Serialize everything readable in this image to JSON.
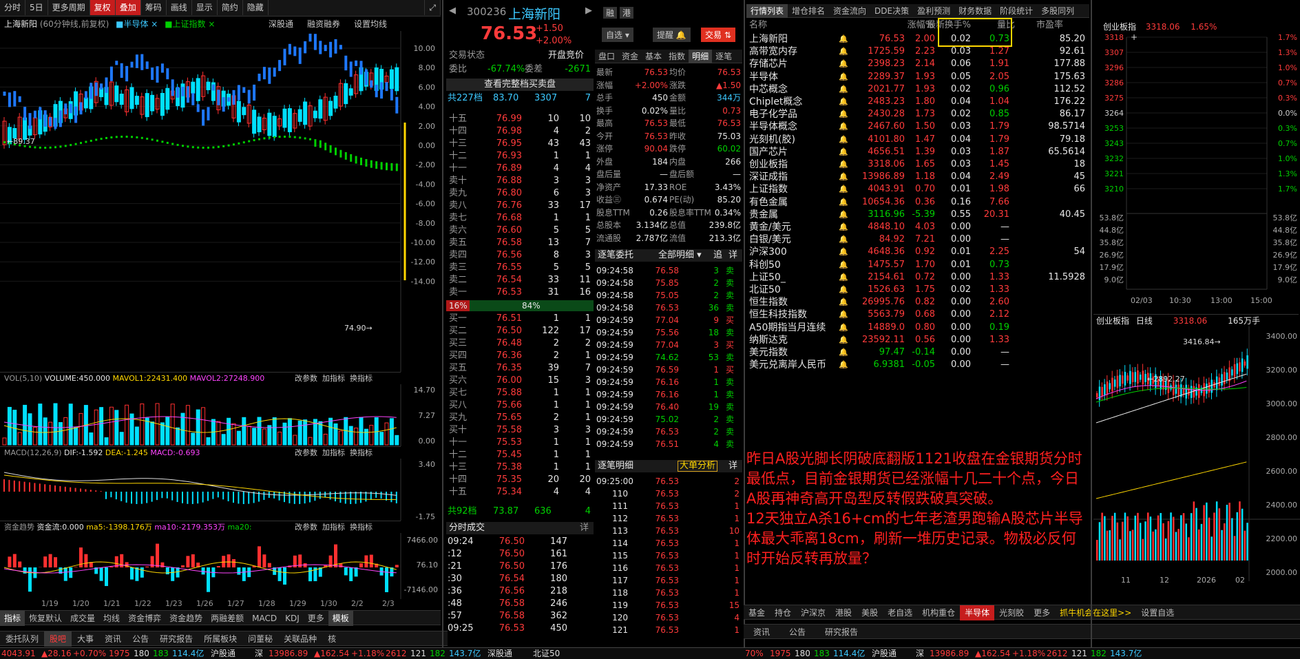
{
  "toolbar": {
    "items": [
      "分时",
      "5日",
      "更多周期",
      "复权",
      "叠加",
      "筹码",
      "画线",
      "显示",
      "简约",
      "隐藏"
    ]
  },
  "chart_header": {
    "name": "上海新阳",
    "desc": "(60分钟线,前复权)",
    "overlays": [
      "半导体",
      "上证指数"
    ],
    "links": [
      "深股通",
      "融资融券",
      "设置均线"
    ]
  },
  "kline": {
    "y_labels": [
      "10.00",
      "8.00",
      "6.00",
      "4.00",
      "2.00",
      "0.00",
      "-2.00",
      "-4.00",
      "-6.00",
      "-8.00",
      "-10.00",
      "-12.00",
      "-14.00"
    ],
    "high_label": "89.37",
    "low_label": "74.90",
    "colors": {
      "up": "#ff3030",
      "down": "#00e0ff",
      "semi": "#1e78ff",
      "index": "#00d000"
    }
  },
  "vol_header": {
    "name": "VOL(5,10)",
    "vol": "VOLUME:450.000",
    "mavol1": "MAVOL1:22431.400",
    "mavol2": "MAVOL2:27248.900",
    "links": [
      "改参数",
      "加指标",
      "换指标"
    ],
    "y": [
      "14.70",
      "7.27",
      "0.00"
    ]
  },
  "macd_header": {
    "name": "MACD(12,26,9)",
    "dif": "DIF:-1.592",
    "dea": "DEA:-1.245",
    "macd": "MACD:-0.693",
    "links": [
      "改参数",
      "加指标",
      "换指标"
    ],
    "y": [
      "3.40",
      "-1.75"
    ]
  },
  "fund_header": {
    "name": "资金趋势",
    "flow": "资金流:0.000",
    "ma5": "ma5:-1398.176万",
    "ma10": "ma10:-2179.353万",
    "ma20": "ma20:",
    "links": [
      "改参数",
      "加指标",
      "换指标"
    ],
    "y": [
      "7466.00",
      "76.10",
      "-7146.00"
    ]
  },
  "x_dates": [
    "1/19",
    "1/20",
    "1/21",
    "1/22",
    "1/23",
    "1/26",
    "1/27",
    "1/28",
    "1/29",
    "1/30",
    "2/2",
    "2/3"
  ],
  "indicator_tabs": [
    "指标",
    "恢复默认",
    "成交量",
    "均线",
    "资金博弈",
    "资金趋势",
    "两融差额",
    "MACD",
    "KDJ",
    "更多",
    "模板"
  ],
  "stock": {
    "code": "300236",
    "name": "上海新阳",
    "price": "76.53",
    "chg": "+1.50",
    "pct": "+2.00%",
    "tags": [
      "融",
      "港"
    ],
    "buttons": [
      "自选",
      "提醒",
      "交易"
    ]
  },
  "quote_state": {
    "title": "交易状态",
    "right": "开盘竞价",
    "wb_label": "委比",
    "wb": "-67.74%",
    "wc_label": "委差",
    "wc": "-2671",
    "full": "查看完整档买卖盘",
    "sell_sum": [
      "共227档",
      "83.70",
      "3307",
      "7"
    ],
    "buy_sum": [
      "共92档",
      "73.87",
      "636",
      "4"
    ],
    "ratio": [
      "16%",
      "84%"
    ]
  },
  "asks": [
    [
      "十五",
      "76.99",
      "10",
      "10"
    ],
    [
      "十四",
      "76.98",
      "4",
      "2"
    ],
    [
      "十三",
      "76.95",
      "43",
      "43"
    ],
    [
      "十二",
      "76.93",
      "1",
      "1"
    ],
    [
      "十一",
      "76.89",
      "4",
      "4"
    ],
    [
      "卖十",
      "76.88",
      "3",
      "3"
    ],
    [
      "卖九",
      "76.80",
      "6",
      "3"
    ],
    [
      "卖八",
      "76.76",
      "33",
      "17"
    ],
    [
      "卖七",
      "76.68",
      "1",
      "1"
    ],
    [
      "卖六",
      "76.60",
      "5",
      "5"
    ],
    [
      "卖五",
      "76.58",
      "13",
      "7"
    ],
    [
      "卖四",
      "76.56",
      "8",
      "3"
    ],
    [
      "卖三",
      "76.55",
      "5",
      "5"
    ],
    [
      "卖二",
      "76.54",
      "33",
      "11"
    ],
    [
      "卖一",
      "76.53",
      "31",
      "16"
    ]
  ],
  "bids": [
    [
      "买一",
      "76.51",
      "1",
      "1"
    ],
    [
      "买二",
      "76.50",
      "122",
      "17"
    ],
    [
      "买三",
      "76.48",
      "2",
      "2"
    ],
    [
      "买四",
      "76.36",
      "2",
      "1"
    ],
    [
      "买五",
      "76.35",
      "39",
      "7"
    ],
    [
      "买六",
      "76.00",
      "15",
      "3"
    ],
    [
      "买七",
      "75.88",
      "1",
      "1"
    ],
    [
      "买八",
      "75.66",
      "1",
      "1"
    ],
    [
      "买九",
      "75.65",
      "2",
      "1"
    ],
    [
      "买十",
      "75.58",
      "3",
      "3"
    ],
    [
      "十一",
      "75.53",
      "1",
      "1"
    ],
    [
      "十二",
      "75.45",
      "1",
      "1"
    ],
    [
      "十三",
      "75.38",
      "1",
      "1"
    ],
    [
      "十四",
      "75.35",
      "20",
      "20"
    ],
    [
      "十五",
      "75.34",
      "4",
      "4"
    ]
  ],
  "fenshi_title": "分时成交",
  "fenshi_more": "详",
  "fenshi": [
    [
      "09:24",
      "76.50",
      "147"
    ],
    [
      ":12",
      "76.50",
      "161"
    ],
    [
      ":21",
      "76.50",
      "176"
    ],
    [
      ":30",
      "76.54",
      "180"
    ],
    [
      ":36",
      "76.56",
      "218"
    ],
    [
      ":48",
      "76.58",
      "246"
    ],
    [
      ":57",
      "76.58",
      "362"
    ],
    [
      "09:25",
      "76.53",
      "450"
    ]
  ],
  "detail_tabs": [
    "盘口",
    "资金",
    "基本",
    "指数",
    "明细",
    "逐笔"
  ],
  "pankou": [
    [
      "最新",
      "76.53",
      "均价",
      "76.53"
    ],
    [
      "涨幅",
      "+2.00%",
      "涨跌",
      "▲1.50"
    ],
    [
      "总手",
      "450",
      "金额",
      "344万"
    ],
    [
      "换手",
      "0.02%",
      "量比",
      "0.73"
    ],
    [
      "最高",
      "76.53",
      "最低",
      "76.53"
    ],
    [
      "今开",
      "76.53",
      "昨收",
      "75.03"
    ],
    [
      "涨停",
      "90.04",
      "跌停",
      "60.02"
    ],
    [
      "外盘",
      "184",
      "内盘",
      "266"
    ],
    [
      "盘后量",
      "—",
      "盘后额",
      "—"
    ],
    [
      "净资产",
      "17.33",
      "ROE",
      "3.43%"
    ],
    [
      "收益㊂",
      "0.674",
      "PE(动)",
      "85.20"
    ],
    [
      "股息TTM",
      "0.26",
      "股息率TTM",
      "0.34%"
    ],
    [
      "总股本",
      "3.134亿",
      "总值",
      "239.8亿"
    ],
    [
      "流通股",
      "2.787亿",
      "流值",
      "213.3亿"
    ]
  ],
  "zhubi": {
    "title": "逐笔委托",
    "filter": "全部明细",
    "btns": [
      "追",
      "详"
    ],
    "rows": [
      [
        "09:24:58",
        "76.58",
        "3",
        "卖"
      ],
      [
        "09:24:58",
        "75.85",
        "2",
        "卖"
      ],
      [
        "09:24:58",
        "75.05",
        "2",
        "卖"
      ],
      [
        "09:24:58",
        "76.53",
        "36",
        "卖"
      ],
      [
        "09:24:59",
        "77.04",
        "9",
        "买"
      ],
      [
        "09:24:59",
        "75.56",
        "18",
        "卖"
      ],
      [
        "09:24:59",
        "77.04",
        "3",
        "买"
      ],
      [
        "09:24:59",
        "74.62",
        "53",
        "卖"
      ],
      [
        "09:24:59",
        "76.59",
        "1",
        "买"
      ],
      [
        "09:24:59",
        "76.16",
        "1",
        "卖"
      ],
      [
        "09:24:59",
        "76.16",
        "1",
        "卖"
      ],
      [
        "09:24:59",
        "76.40",
        "19",
        "卖"
      ],
      [
        "09:24:59",
        "75.02",
        "2",
        "卖"
      ],
      [
        "09:24:59",
        "76.53",
        "2",
        "卖"
      ],
      [
        "09:24:59",
        "76.51",
        "4",
        "卖"
      ]
    ]
  },
  "mingxi": {
    "title": "逐笔明细",
    "btn": "大单分析",
    "more": "详",
    "first": [
      "09:25:00",
      "76.53",
      "2"
    ],
    "rows": [
      [
        "110",
        "76.53",
        "2"
      ],
      [
        "111",
        "76.53",
        "1"
      ],
      [
        "112",
        "76.53",
        "1"
      ],
      [
        "113",
        "76.53",
        "10"
      ],
      [
        "114",
        "76.53",
        "1"
      ],
      [
        "115",
        "76.53",
        "1"
      ],
      [
        "116",
        "76.53",
        "1"
      ],
      [
        "117",
        "76.53",
        "1"
      ],
      [
        "118",
        "76.53",
        "1"
      ],
      [
        "119",
        "76.53",
        "15"
      ],
      [
        "120",
        "76.53",
        "4"
      ],
      [
        "121",
        "76.53",
        "1"
      ]
    ]
  },
  "list_tabs": [
    "行情列表",
    "增仓排名",
    "资金流向",
    "DDE决策",
    "盈利预测",
    "财务数据",
    "阶段统计",
    "多股同列"
  ],
  "list_cols": [
    "名称",
    "最新",
    "涨幅%",
    "换手%",
    "量比",
    "市盈率"
  ],
  "list_rows": [
    [
      "上海新阳",
      "76.53",
      "2.00",
      "0.02",
      "0.73",
      "85.20"
    ],
    [
      "高带宽内存",
      "1725.59",
      "2.23",
      "0.03",
      "1.27",
      "92.61"
    ],
    [
      "存储芯片",
      "2398.23",
      "2.14",
      "0.06",
      "1.91",
      "177.88"
    ],
    [
      "半导体",
      "2289.37",
      "1.93",
      "0.05",
      "2.05",
      "175.63"
    ],
    [
      "中芯概念",
      "2021.77",
      "1.93",
      "0.02",
      "0.96",
      "112.52"
    ],
    [
      "Chiplet概念",
      "2483.23",
      "1.80",
      "0.04",
      "1.04",
      "176.22"
    ],
    [
      "电子化学品",
      "2430.28",
      "1.73",
      "0.02",
      "0.85",
      "86.17"
    ],
    [
      "半导体概念",
      "2467.60",
      "1.50",
      "0.03",
      "1.79",
      "98.5714"
    ],
    [
      "光刻机(胶)",
      "4101.80",
      "1.47",
      "0.04",
      "1.79",
      "79.18"
    ],
    [
      "国产芯片",
      "4656.51",
      "1.39",
      "0.03",
      "1.87",
      "65.5614"
    ],
    [
      "创业板指",
      "3318.06",
      "1.65",
      "0.03",
      "1.45",
      "18"
    ],
    [
      "深证成指",
      "13986.89",
      "1.18",
      "0.04",
      "2.49",
      "45"
    ],
    [
      "上证指数",
      "4043.91",
      "0.70",
      "0.01",
      "1.98",
      "66"
    ],
    [
      "有色金属",
      "10654.36",
      "0.36",
      "0.16",
      "7.66",
      ""
    ],
    [
      "贵金属",
      "3116.96",
      "-5.39",
      "0.55",
      "20.31",
      "40.45"
    ],
    [
      "黄金/美元",
      "4848.10",
      "4.03",
      "0.00",
      "—",
      ""
    ],
    [
      "白银/美元",
      "84.92",
      "7.21",
      "0.00",
      "—",
      ""
    ],
    [
      "沪深300",
      "4648.36",
      "0.92",
      "0.01",
      "2.25",
      "54"
    ],
    [
      "科创50",
      "1475.57",
      "1.70",
      "0.01",
      "0.73",
      ""
    ],
    [
      "上证50_",
      "2154.61",
      "0.72",
      "0.00",
      "1.33",
      "11.5928"
    ],
    [
      "北证50",
      "1526.63",
      "1.75",
      "0.02",
      "1.33",
      ""
    ],
    [
      "恒生指数",
      "26995.76",
      "0.82",
      "0.00",
      "2.60",
      ""
    ],
    [
      "恒生科技指数",
      "5563.79",
      "0.68",
      "0.00",
      "2.12",
      ""
    ],
    [
      "A50期指当月连续",
      "14889.0",
      "0.80",
      "0.00",
      "0.19",
      ""
    ],
    [
      "纳斯达克",
      "23592.11",
      "0.56",
      "0.00",
      "1.33",
      ""
    ],
    [
      "美元指数",
      "97.47",
      "-0.14",
      "0.00",
      "—",
      ""
    ],
    [
      "美元兑离岸人民币",
      "6.9381",
      "-0.05",
      "0.00",
      "—",
      ""
    ]
  ],
  "comment": "昨日A股光脚长阴破底翻版1121收盘在金银期货分时最低点，目前金银期货已经涨幅十几二十个点，今日A股再神奇高开岛型反转假跌破真突破。\n12天独立A杀16+cm的七年老渣男跑输A股芯片半导体最大乖离18cm，刷新一堆历史记录。物极必反何时开始反转再放量？",
  "mini": {
    "title": "创业板指",
    "price": "3318.06",
    "pct": "1.65%",
    "y_left": [
      "3318",
      "3307",
      "3296",
      "3286",
      "3275",
      "3264",
      "3253",
      "3243",
      "3232",
      "3221",
      "3210"
    ],
    "y_right": [
      "1.7%",
      "1.3%",
      "1.0%",
      "0.7%",
      "0.3%",
      "0.0%",
      "0.3%",
      "0.7%",
      "1.0%",
      "1.3%",
      "1.7%"
    ],
    "vol_y": [
      "53.8亿",
      "44.8亿",
      "35.8亿",
      "26.9亿",
      "17.9亿",
      "9.0亿"
    ],
    "x": [
      "02/03",
      "10:30",
      "13:00",
      "15:00"
    ]
  },
  "daily": {
    "title": "创业板指",
    "period": "日线",
    "price": "3318.06",
    "vol": "165万手",
    "hi": "3416.84",
    "lo": "2892.27",
    "y": [
      "3400.00",
      "3200.00",
      "3000.00",
      "2800.00",
      "2600.00",
      "2400.00",
      "2200.00",
      "2000.00"
    ],
    "x": [
      "11",
      "12",
      "2026",
      "02"
    ]
  },
  "list_bottom_tabs": [
    "基金",
    "持仓",
    "沪深京",
    "港股",
    "美股",
    "老自选",
    "机构重仓",
    "半导体",
    "光刻胶",
    "更多",
    "抓牛机会在这里>>",
    "设置自选"
  ],
  "bottom_mid_tabs": [
    "委托队列",
    "股吧",
    "大事",
    "资讯",
    "公告",
    "研究报告",
    "所属板块",
    "问董秘",
    "关联品种",
    "核"
  ],
  "bottom_right_tabs": [
    "资讯",
    "公告",
    "研究报告"
  ],
  "status": {
    "seg1": [
      "4043.91",
      "▲28.16",
      "+0.70%",
      "1975",
      "180",
      "183",
      "114.4亿"
    ],
    "sh": "沪股通",
    "seg2": [
      "深",
      "13986.89",
      "▲162.54",
      "+1.18%",
      "2612",
      "121",
      "182",
      "143.7亿"
    ],
    "sz": "深股通",
    "bz": "北证50",
    "seg3": [
      "70%",
      "1975",
      "180",
      "183",
      "114.4亿"
    ],
    "sh2": "沪股通",
    "seg4": [
      "深",
      "13986.89",
      "▲162.54",
      "+1.18%",
      "2612",
      "121",
      "182",
      "143.7亿"
    ]
  }
}
